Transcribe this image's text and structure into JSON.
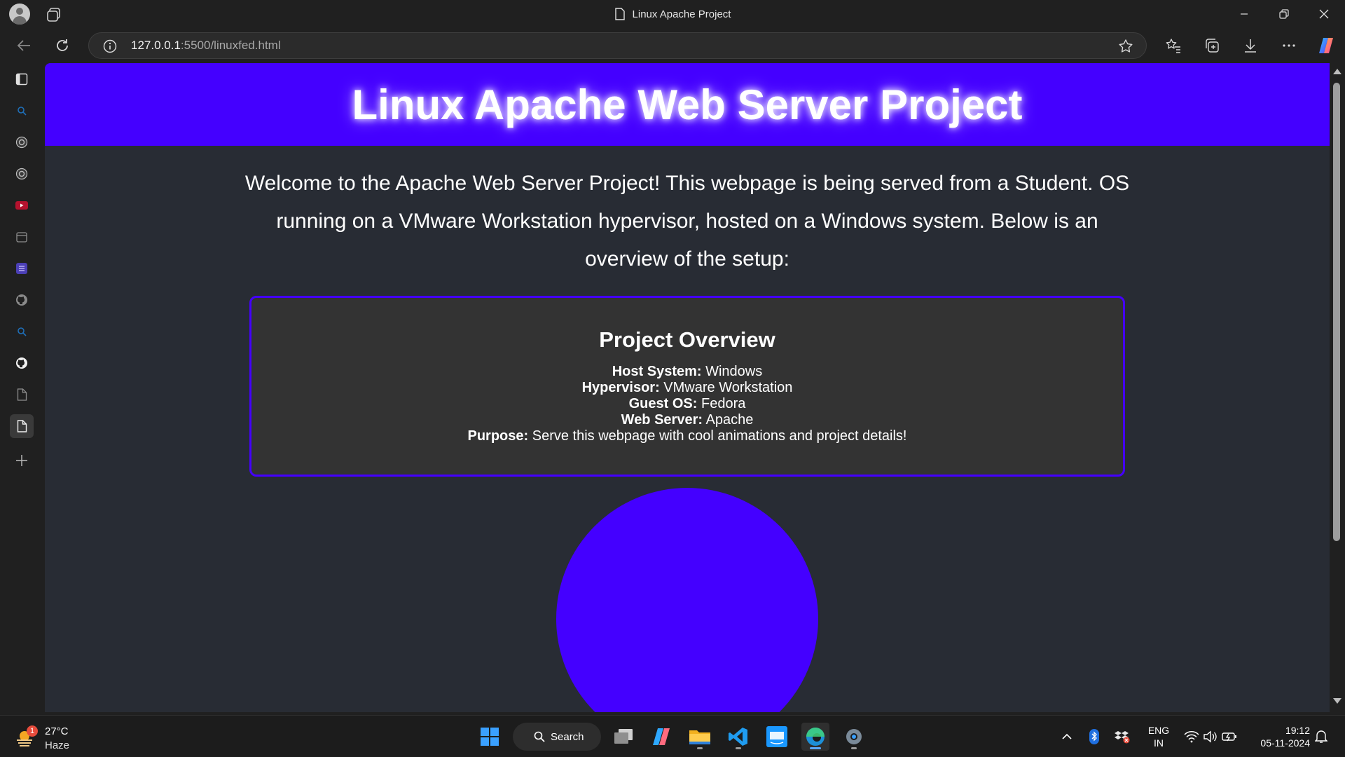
{
  "browser": {
    "tab_title": "Linux Apache Project",
    "url_host": "127.0.0.1",
    "url_rest": ":5500/linuxfed.html"
  },
  "page": {
    "heading": "Linux Apache Web Server Project",
    "intro": "Welcome to the Apache Web Server Project! This webpage is being served from a Student. OS running on a VMware Workstation hypervisor, hosted on a Windows system. Below is an overview of the setup:",
    "overview": {
      "title": "Project Overview",
      "rows": [
        {
          "label": "Host System:",
          "value": " Windows"
        },
        {
          "label": "Hypervisor:",
          "value": " VMware Workstation"
        },
        {
          "label": "Guest OS:",
          "value": " Fedora"
        },
        {
          "label": "Web Server:",
          "value": " Apache"
        },
        {
          "label": "Purpose:",
          "value": " Serve this webpage with cool animations and project details!"
        }
      ]
    },
    "colors": {
      "accent": "#4400ff",
      "background": "#282c34",
      "card": "#333333"
    }
  },
  "sidebar": {
    "icons": [
      "sidebar-panel-icon",
      "search-icon",
      "chatgpt-icon",
      "chatgpt-icon",
      "youtube-icon",
      "calendar-icon",
      "list-icon",
      "github-icon",
      "search-icon",
      "github-icon",
      "document-icon",
      "document-icon",
      "add-icon"
    ]
  },
  "taskbar": {
    "weather": {
      "badge": "1",
      "temp": "27°C",
      "condition": "Haze"
    },
    "search_label": "Search",
    "language": {
      "line1": "ENG",
      "line2": "IN"
    },
    "clock": {
      "time": "19:12",
      "date": "05-11-2024"
    }
  }
}
